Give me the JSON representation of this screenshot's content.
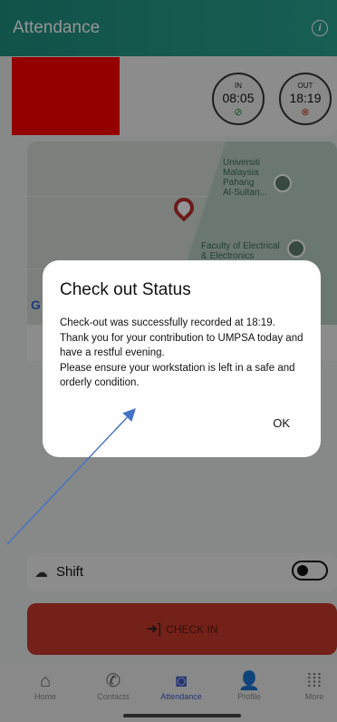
{
  "header": {
    "title": "Attendance",
    "info_icon": "info-icon"
  },
  "status": {
    "in": {
      "label": "IN",
      "time": "08:05",
      "icon": "check-circle-icon"
    },
    "out": {
      "label": "OUT",
      "time": "18:19",
      "icon": "x-circle-icon"
    }
  },
  "map": {
    "label_university": "Universiti\nMalaysia\nPahang\nAl-Sultan...",
    "label_faculty": "Faculty of Electrical\n& Electronics",
    "attribution": "G"
  },
  "shift": {
    "label": "Shift",
    "icon": "cloud-icon",
    "toggle_on": false
  },
  "checkin": {
    "label": "CHECK IN",
    "icon": "login-arrow-icon"
  },
  "nav": {
    "items": [
      {
        "label": "Home",
        "icon": "home-icon"
      },
      {
        "label": "Contacts",
        "icon": "phone-icon"
      },
      {
        "label": "Attendance",
        "icon": "clock-badge-icon"
      },
      {
        "label": "Profile",
        "icon": "person-icon"
      },
      {
        "label": "More",
        "icon": "grid-icon"
      }
    ],
    "active": "Attendance"
  },
  "dialog": {
    "title": "Check out Status",
    "message": "Check-out was successfully recorded at 18:19.\nThank you for your contribution to UMPSA today and have a restful evening.\nPlease ensure your workstation is left in a safe and orderly condition.",
    "ok_label": "OK"
  },
  "colors": {
    "header": "#1f8f7f",
    "checkin": "#c63a2c",
    "accent": "#3b5bc8",
    "redaction": "#ff0000"
  }
}
